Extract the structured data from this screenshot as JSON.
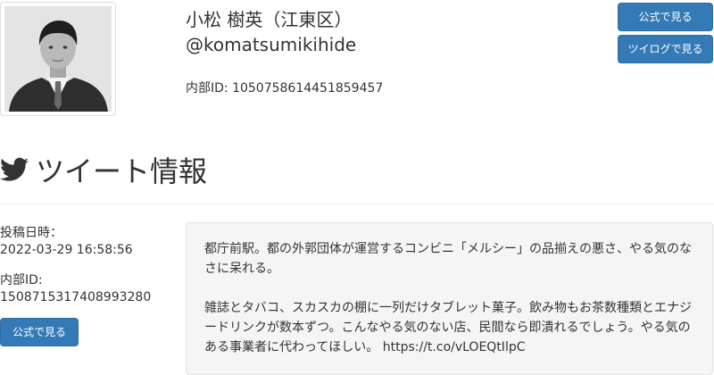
{
  "profile": {
    "name": "小松 樹英（江東区）",
    "handle": "@komatsumikihide",
    "internal_id": "内部ID: 1050758614451859457",
    "avatar_icon": "person-photo"
  },
  "header_buttons": {
    "official": "公式で見る",
    "twilog": "ツイログで見る"
  },
  "section": {
    "icon": "twitter-bird-icon",
    "title": "ツイート情報"
  },
  "tweet_meta": {
    "posted_label": "投稿日時：",
    "posted_value": "2022-03-29 16:58:56",
    "id_label": "内部ID:",
    "id_value": "1508715317408993280",
    "official_button": "公式で見る"
  },
  "tweet": {
    "paragraph1": "都庁前駅。都の外郭団体が運営するコンビニ「メルシー」の品揃えの悪さ、やる気のなさに呆れる。",
    "paragraph2": "雑誌とタバコ、スカスカの棚に一列だけタブレット菓子。飲み物もお茶数種類とエナジードリンクが数本ずつ。こんなやる気のない店、民間なら即潰れるでしょう。やる気のある事業者に代わってほしい。 https://t.co/vLOEQtIlpC"
  },
  "colors": {
    "button_primary": "#337ab7",
    "tweet_background": "#f5f5f5",
    "text": "#333333"
  }
}
